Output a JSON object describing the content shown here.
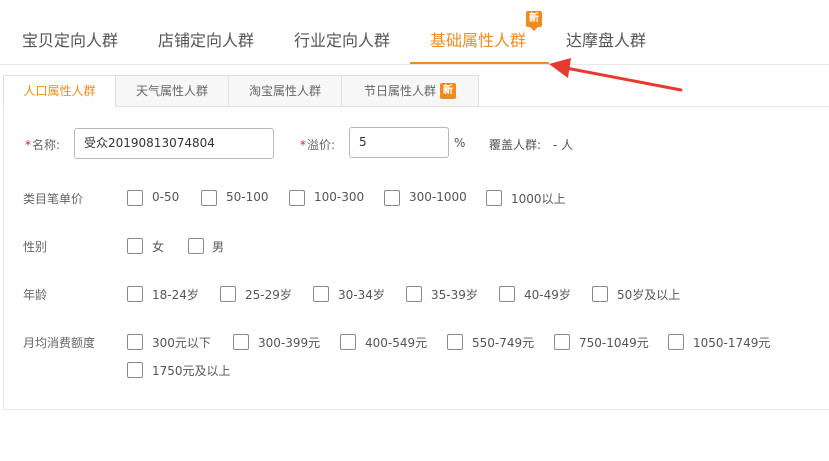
{
  "top_tabs": [
    {
      "label": "宝贝定向人群"
    },
    {
      "label": "店铺定向人群"
    },
    {
      "label": "行业定向人群"
    },
    {
      "label": "基础属性人群",
      "badge": "新"
    },
    {
      "label": "达摩盘人群"
    }
  ],
  "sub_tabs": [
    {
      "label": "人口属性人群"
    },
    {
      "label": "天气属性人群"
    },
    {
      "label": "淘宝属性人群"
    },
    {
      "label": "节日属性人群",
      "badge": "新"
    }
  ],
  "form": {
    "required_mark": "*",
    "name_label": "名称:",
    "name_value": "受众20190813074804",
    "premium_label": "溢价:",
    "premium_value": "5",
    "premium_unit": "%",
    "coverage_label": "覆盖人群:",
    "coverage_value": "- 人"
  },
  "filters": {
    "price": {
      "label": "类目笔单价",
      "options": [
        "0-50",
        "50-100",
        "100-300",
        "300-1000",
        "1000以上"
      ]
    },
    "gender": {
      "label": "性别",
      "options": [
        "女",
        "男"
      ]
    },
    "age": {
      "label": "年龄",
      "options": [
        "18-24岁",
        "25-29岁",
        "30-34岁",
        "35-39岁",
        "40-49岁",
        "50岁及以上"
      ]
    },
    "spend": {
      "label": "月均消费额度",
      "options": [
        "300元以下",
        "300-399元",
        "400-549元",
        "550-749元",
        "750-1049元",
        "1050-1749元",
        "1750元及以上"
      ]
    }
  },
  "colors": {
    "accent": "#f08c1e",
    "arrow": "#e63a2e",
    "required": "#e02020"
  }
}
